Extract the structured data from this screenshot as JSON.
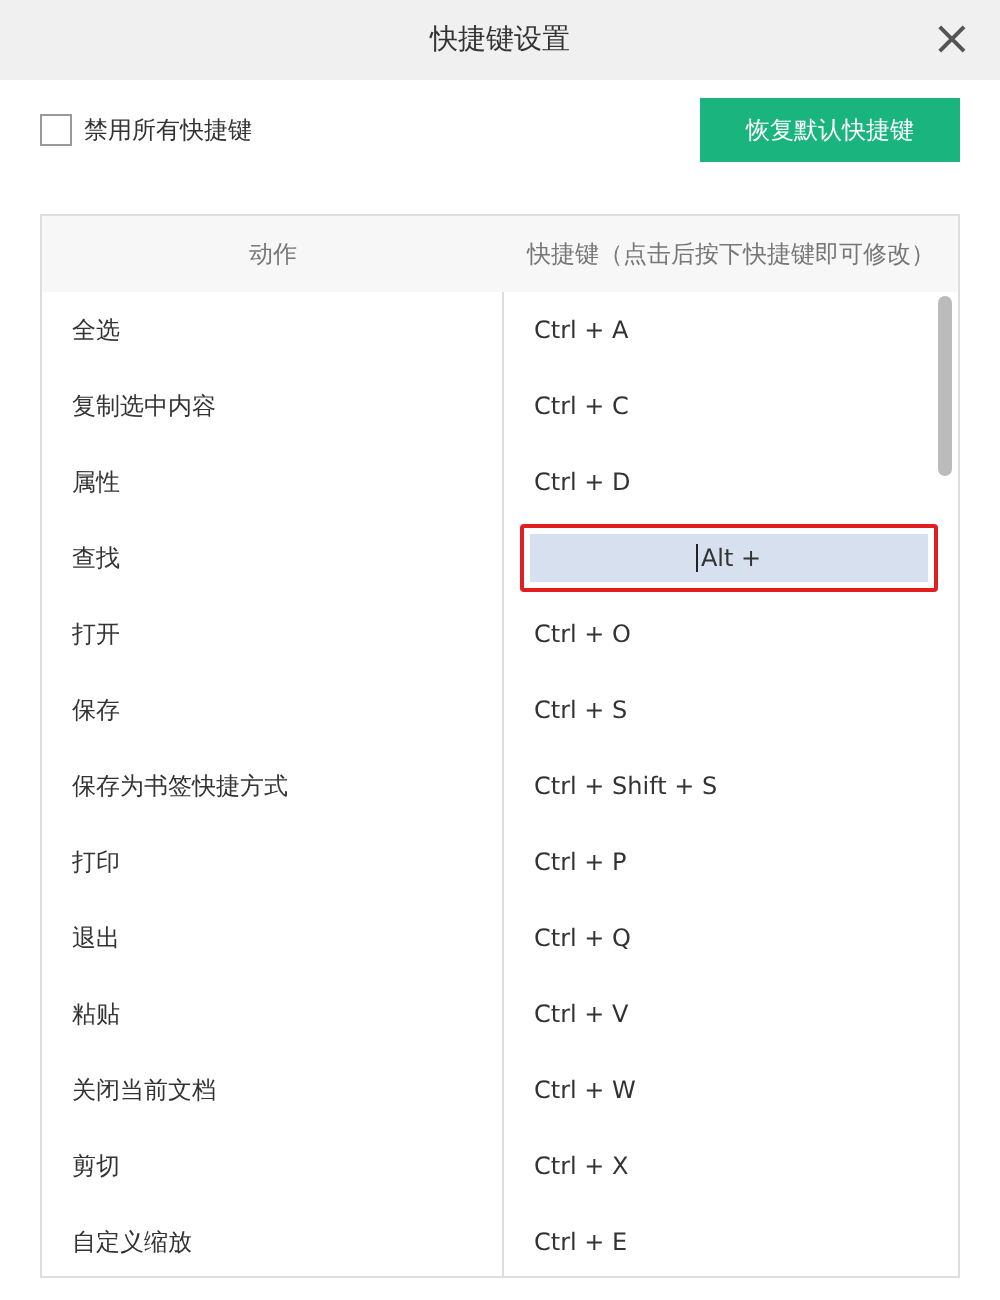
{
  "window": {
    "title": "快捷键设置",
    "close": "×"
  },
  "disable_all": {
    "label": "禁用所有快捷键",
    "checked": false
  },
  "restore_button": "恢复默认快捷键",
  "table": {
    "columns": [
      "动作",
      "快捷键（点击后按下快捷键即可修改）"
    ],
    "rows": [
      {
        "action": "全选",
        "shortcut": "Ctrl + A",
        "editing": false
      },
      {
        "action": "复制选中内容",
        "shortcut": "Ctrl + C",
        "editing": false
      },
      {
        "action": "属性",
        "shortcut": "Ctrl + D",
        "editing": false
      },
      {
        "action": "查找",
        "shortcut": "Alt +",
        "editing": true
      },
      {
        "action": "打开",
        "shortcut": "Ctrl + O",
        "editing": false
      },
      {
        "action": "保存",
        "shortcut": "Ctrl + S",
        "editing": false
      },
      {
        "action": "保存为书签快捷方式",
        "shortcut": "Ctrl + Shift + S",
        "editing": false
      },
      {
        "action": "打印",
        "shortcut": "Ctrl + P",
        "editing": false
      },
      {
        "action": "退出",
        "shortcut": "Ctrl + Q",
        "editing": false
      },
      {
        "action": "粘贴",
        "shortcut": "Ctrl + V",
        "editing": false
      },
      {
        "action": "关闭当前文档",
        "shortcut": "Ctrl + W",
        "editing": false
      },
      {
        "action": "剪切",
        "shortcut": "Ctrl + X",
        "editing": false
      },
      {
        "action": "自定义缩放",
        "shortcut": "Ctrl + E",
        "editing": false
      }
    ]
  }
}
